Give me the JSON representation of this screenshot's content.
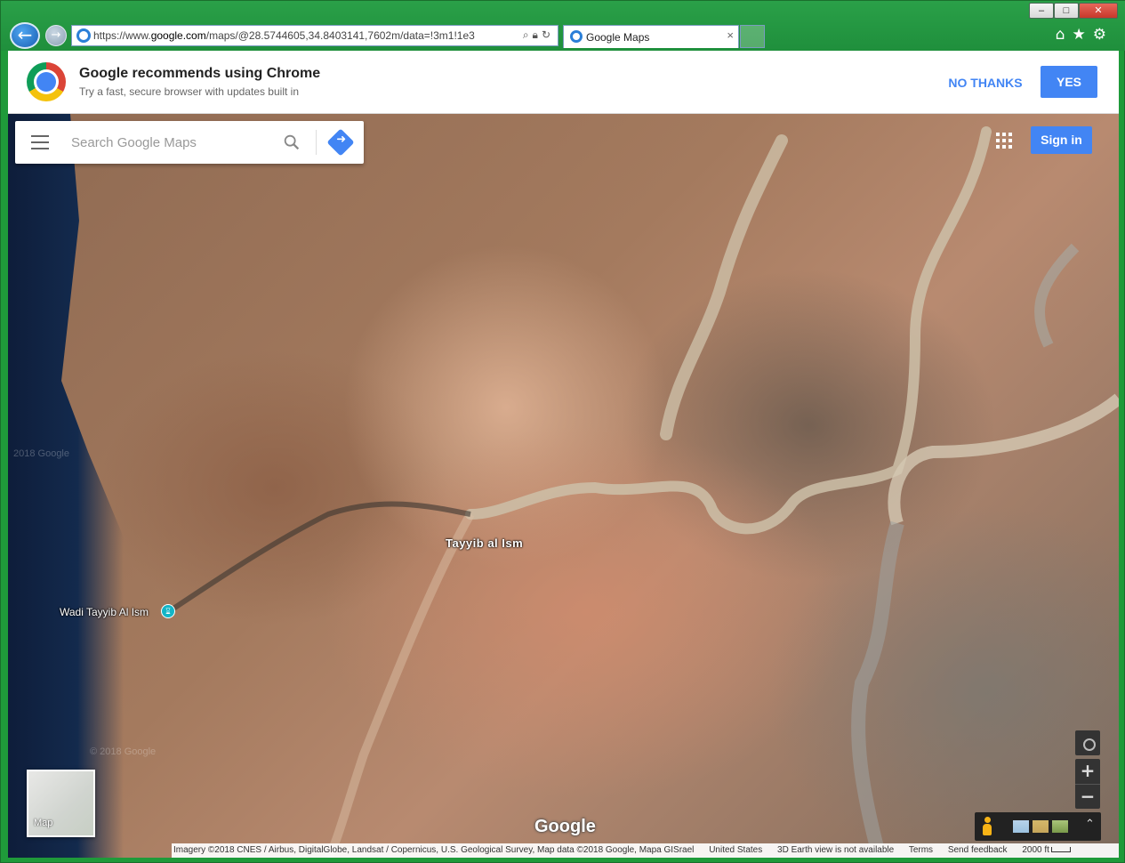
{
  "browser": {
    "url_prefix": "https://www.",
    "url_domain": "google.com",
    "url_rest": "/maps/@28.5744605,34.8403141,7602m/data=!3m1!1e3",
    "tab_title": "Google Maps",
    "tab_close": "×",
    "window_controls": {
      "minimize": "–",
      "maximize": "□",
      "close": "✕"
    },
    "tool_icons": "⌂★⚙"
  },
  "banner": {
    "title": "Google recommends using Chrome",
    "subtitle": "Try a fast, secure browser with updates built in",
    "no_thanks": "NO THANKS",
    "yes": "YES"
  },
  "maps": {
    "search_placeholder": "Search Google Maps",
    "sign_in": "Sign in",
    "place_town": "Tayyib al Ism",
    "place_wadi": "Wadi Tayyib Al Ism",
    "watermark": "© 2018 Google",
    "watermark_left": "2018 Google",
    "layer_label": "Map",
    "google_logo": "Google",
    "zoom_in": "+",
    "zoom_out": "−",
    "expand": "⌃",
    "footer": {
      "imagery": "Imagery ©2018 CNES / Airbus, DigitalGlobe, Landsat / Copernicus, U.S. Geological Survey, Map data ©2018 Google, Mapa GISrael",
      "region": "United States",
      "earth_note": "3D Earth view is not available",
      "terms": "Terms",
      "feedback": "Send feedback",
      "scale": "2000 ft"
    }
  }
}
